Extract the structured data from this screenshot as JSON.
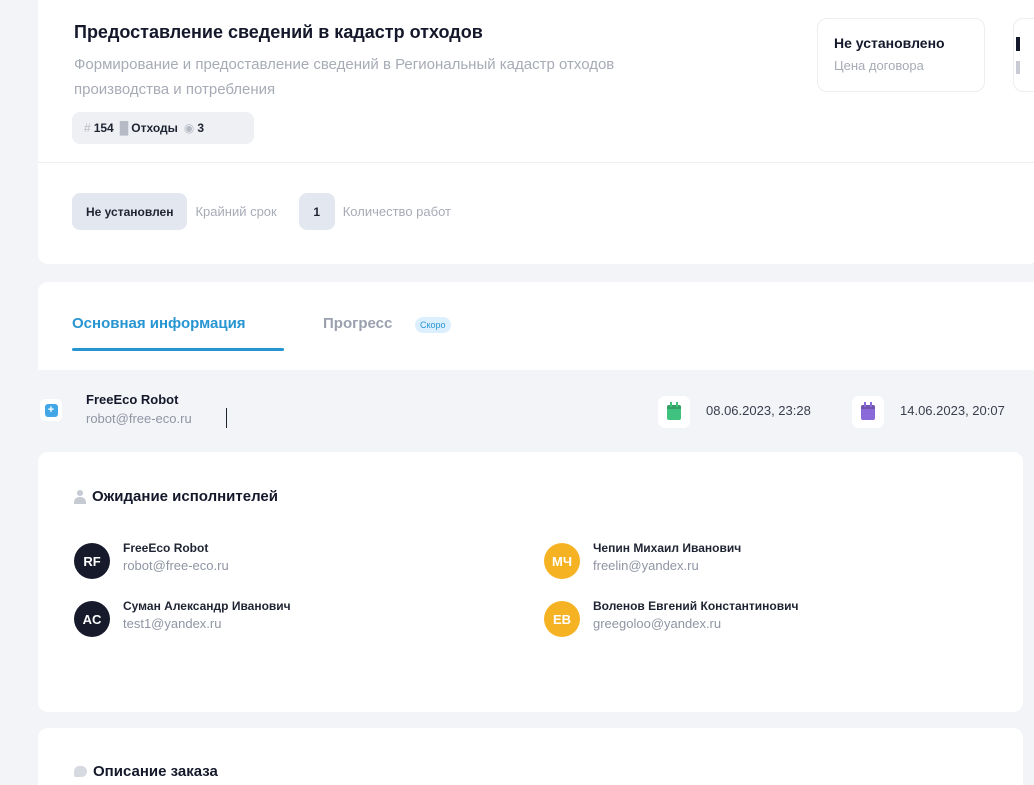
{
  "order": {
    "title": "Предоставление сведений в кадастр отходов",
    "subtitle": "Формирование и предоставление сведений в Региональный кадастр отходов производства и потребления",
    "tags": {
      "number": "154",
      "category": "Отходы",
      "views": "3",
      "icons": [
        "hash-icon",
        "trash-icon",
        "eye-icon"
      ]
    },
    "price": {
      "value": "Не установлено",
      "label": "Цена договора"
    }
  },
  "meta": {
    "deadline_value": "Не установлен",
    "deadline_label": "Крайний срок",
    "works_count": "1",
    "works_label": "Количество работ"
  },
  "tabs": {
    "main_label": "Основная информация",
    "progress_label": "Прогресс",
    "progress_badge": "Скоро"
  },
  "author": {
    "name": "FreeEco Robot",
    "email": "robot@free-eco.ru",
    "created_at": "08.06.2023, 23:28",
    "deadline_at": "14.06.2023, 20:07"
  },
  "executors": {
    "title": "Ожидание исполнителей",
    "items": [
      {
        "initials": "RF",
        "name": "FreeEco Robot",
        "email": "robot@free-eco.ru",
        "color": "#161a2b"
      },
      {
        "initials": "МЧ",
        "name": "Чепин Михаил Иванович",
        "email": "freelin@yandex.ru",
        "color": "#f5b324"
      },
      {
        "initials": "AC",
        "name": "Суман Александр Иванович",
        "email": "test1@yandex.ru",
        "color": "#161a2b"
      },
      {
        "initials": "EB",
        "name": "Воленов Евгений Константинович",
        "email": "greegoloo@yandex.ru",
        "color": "#f5b324"
      }
    ]
  },
  "description": {
    "title": "Описание заказа"
  },
  "colors": {
    "accent": "#2795d1",
    "background": "#f3f4f8",
    "avatar_dark": "#161a2b",
    "avatar_orange": "#f5b324",
    "calendar_green": "#3fc27d",
    "calendar_purple": "#8a6ad8"
  }
}
